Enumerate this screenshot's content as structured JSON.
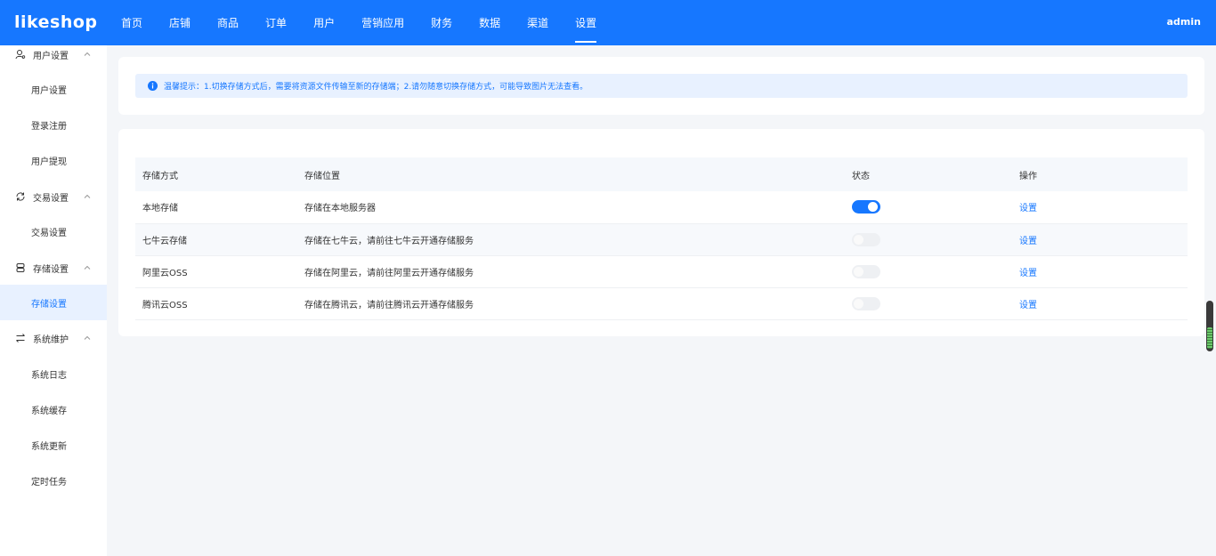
{
  "header": {
    "logo": "likeshop",
    "nav": [
      "首页",
      "店铺",
      "商品",
      "订单",
      "用户",
      "营销应用",
      "财务",
      "数据",
      "渠道",
      "设置"
    ],
    "active_nav": 9,
    "user": "admin"
  },
  "sidebar": {
    "groups": [
      {
        "label": "用户设置",
        "icon": "user-settings-icon",
        "items": [
          "用户设置",
          "登录注册",
          "用户提现"
        ]
      },
      {
        "label": "交易设置",
        "icon": "sync-icon",
        "items": [
          "交易设置"
        ]
      },
      {
        "label": "存储设置",
        "icon": "database-icon",
        "items": [
          "存储设置"
        ]
      },
      {
        "label": "系统维护",
        "icon": "swap-icon",
        "items": [
          "系统日志",
          "系统缓存",
          "系统更新",
          "定时任务"
        ]
      }
    ],
    "active_item": "存储设置"
  },
  "notice": {
    "text": "温馨提示：1.切换存储方式后，需要将资源文件传输至新的存储端；2.请勿随意切换存储方式，可能导致图片无法查看。"
  },
  "table": {
    "columns": [
      "存储方式",
      "存储位置",
      "状态",
      "操作"
    ],
    "rows": [
      {
        "method": "本地存储",
        "location": "存储在本地服务器",
        "enabled": true,
        "action": "设置"
      },
      {
        "method": "七牛云存储",
        "location": "存储在七牛云，请前往七牛云开通存储服务",
        "enabled": false,
        "action": "设置"
      },
      {
        "method": "阿里云OSS",
        "location": "存储在阿里云，请前往阿里云开通存储服务",
        "enabled": false,
        "action": "设置"
      },
      {
        "method": "腾讯云OSS",
        "location": "存储在腾讯云，请前往腾讯云开通存储服务",
        "enabled": false,
        "action": "设置"
      }
    ]
  },
  "colors": {
    "primary": "#1677ff",
    "background": "#f4f6f9",
    "notice_bg": "#e8f1ff"
  }
}
